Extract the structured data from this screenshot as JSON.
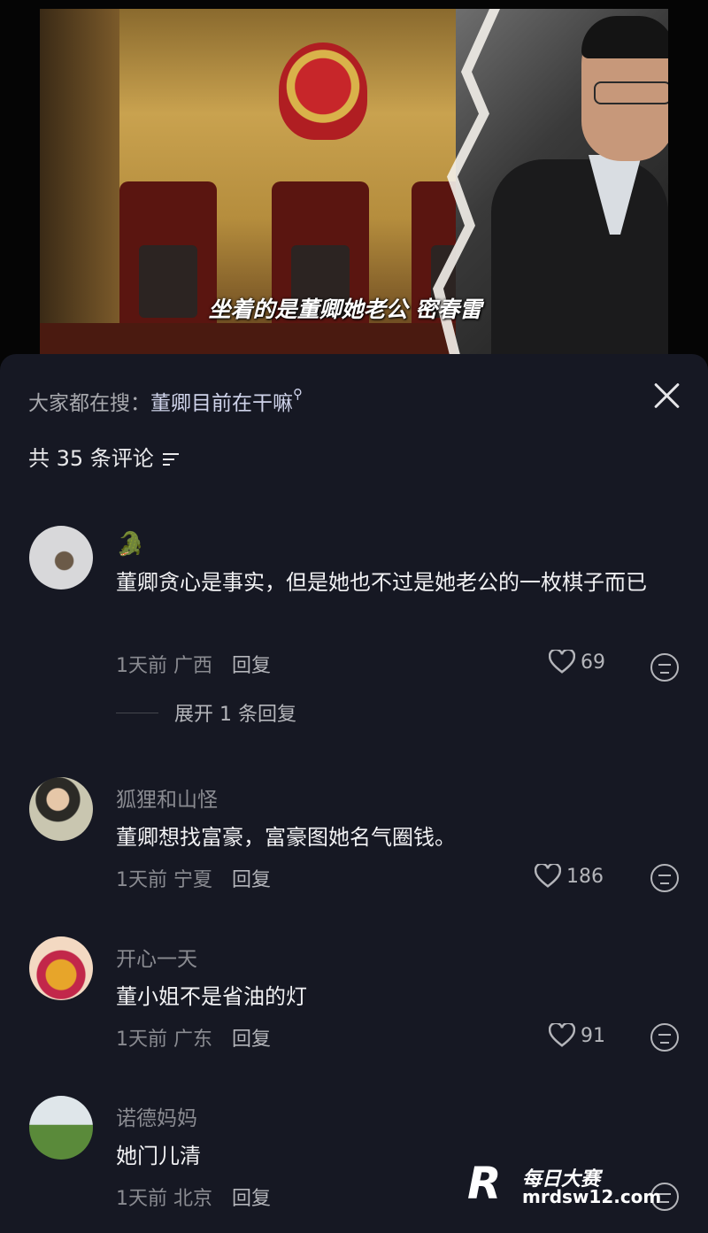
{
  "video": {
    "subtitle": "坐着的是董卿她老公 密春雷"
  },
  "sheet": {
    "search_prefix": "大家都在搜：",
    "search_term": "董卿目前在干嘛",
    "comment_count": "共 35 条评论"
  },
  "comments": [
    {
      "name": "🐊",
      "text": "董卿贪心是事实，但是她也不过是她老公的一枚棋子而已",
      "time": "1天前",
      "region": "广西",
      "reply_label": "回复",
      "likes": "69",
      "expand_label": "展开 1 条回复"
    },
    {
      "name": "狐狸和山怪",
      "text": "董卿想找富豪，富豪图她名气圈钱。",
      "time": "1天前",
      "region": "宁夏",
      "reply_label": "回复",
      "likes": "186"
    },
    {
      "name": "开心一天",
      "text": "董小姐不是省油的灯",
      "time": "1天前",
      "region": "广东",
      "reply_label": "回复",
      "likes": "91"
    },
    {
      "name": "诺德妈妈",
      "text": "她门儿清",
      "time": "1天前",
      "region": "北京",
      "reply_label": "回复"
    }
  ],
  "watermark": {
    "logo": "R",
    "title": "每日大赛",
    "url": "mrdsw12.com"
  }
}
